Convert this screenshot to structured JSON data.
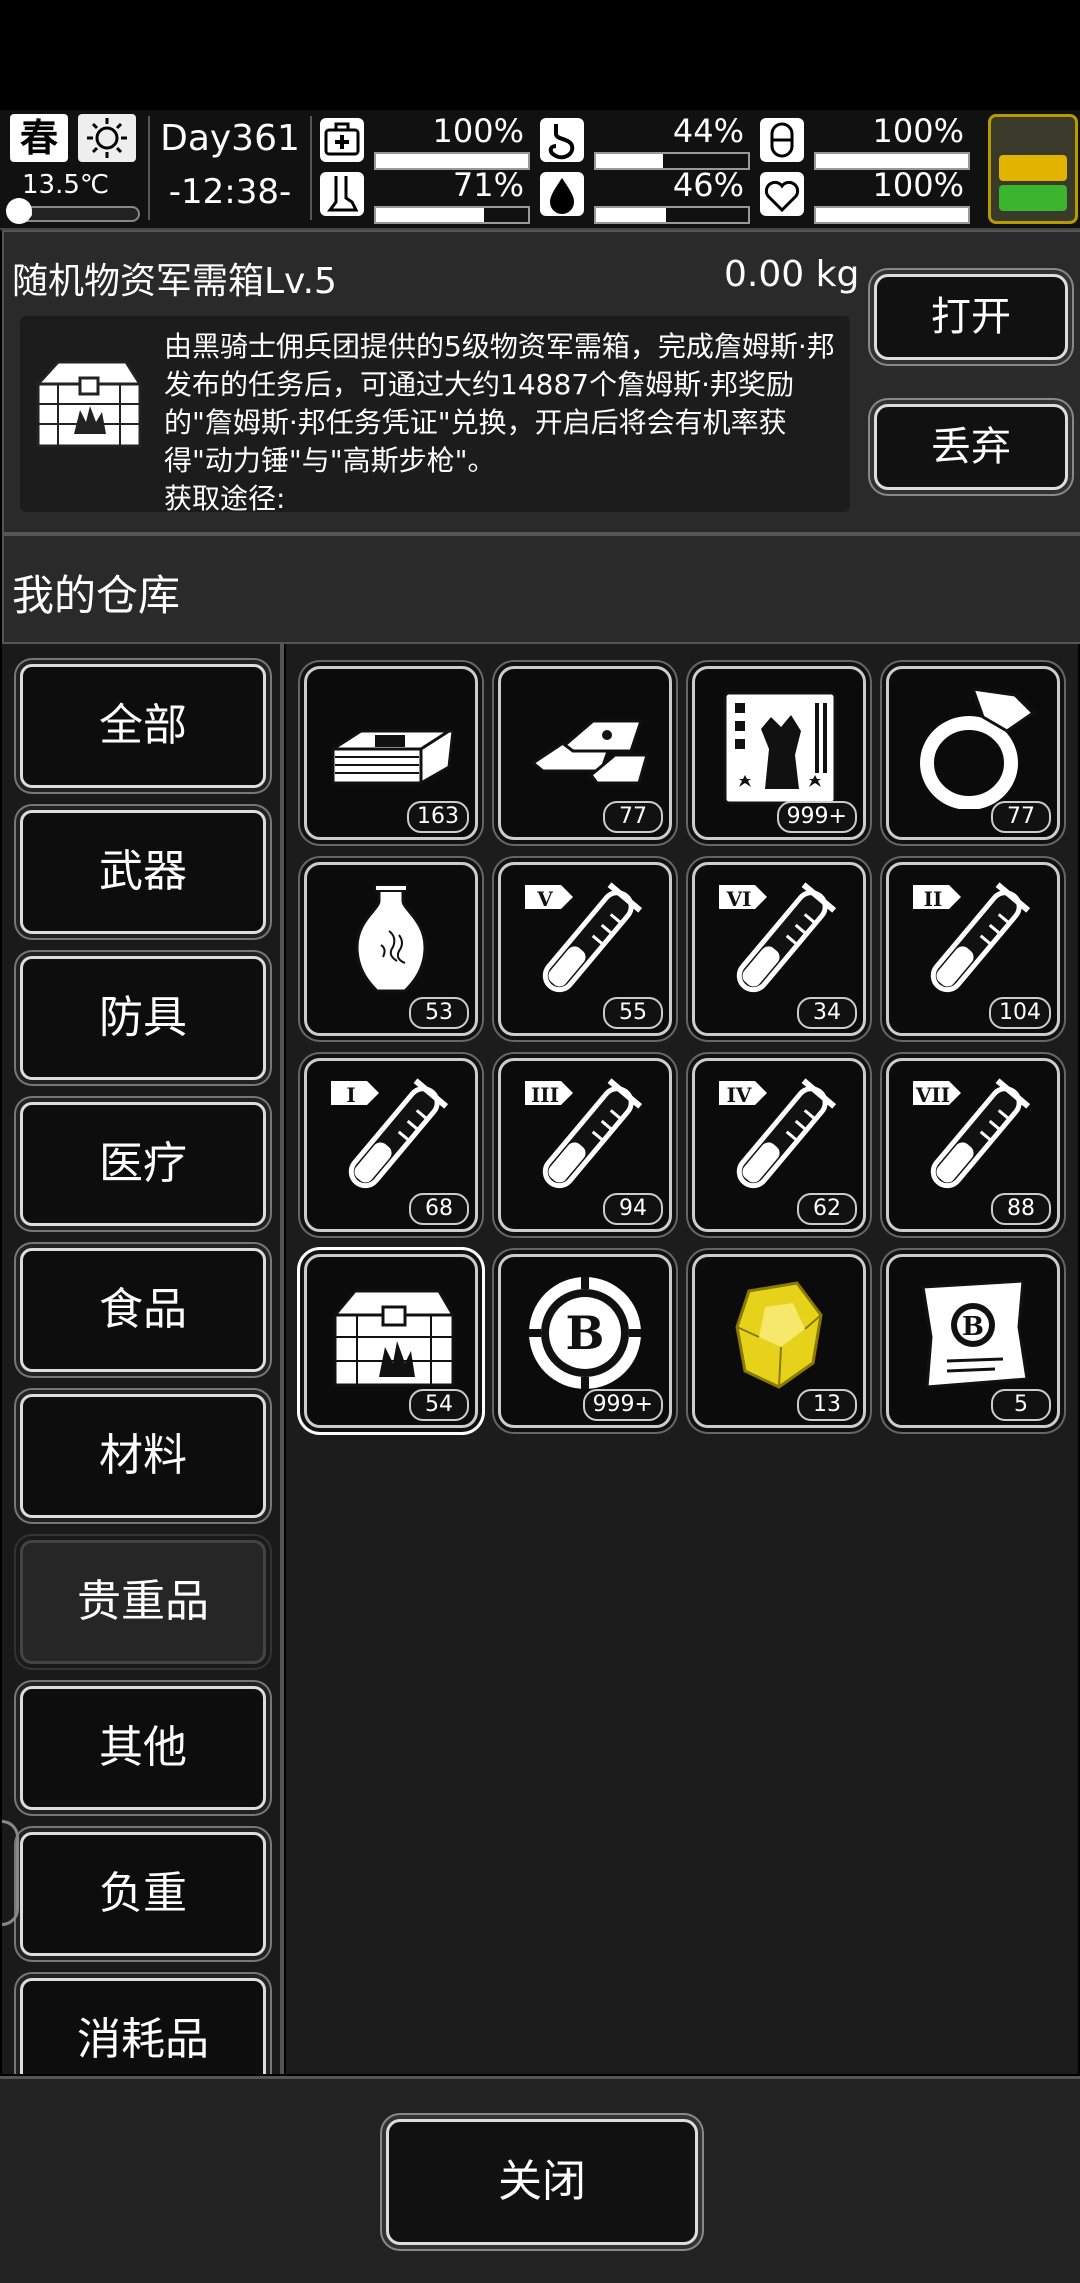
{
  "status": {
    "season": "春",
    "weather_icon": "sun-icon",
    "temperature": "13.5℃",
    "temperature_level": 0.15,
    "day": "Day361",
    "time": "-12:38-",
    "stats": [
      {
        "name": "health",
        "icon": "first-aid-icon",
        "value": "100%",
        "level": 1.0
      },
      {
        "name": "hunger",
        "icon": "stomach-icon",
        "value": "44%",
        "level": 0.44
      },
      {
        "name": "medicine",
        "icon": "pill-icon",
        "value": "100%",
        "level": 1.0
      },
      {
        "name": "stamina",
        "icon": "leg-icon",
        "value": "71%",
        "level": 0.71
      },
      {
        "name": "thirst",
        "icon": "water-drop-icon",
        "value": "46%",
        "level": 0.46
      },
      {
        "name": "mood",
        "icon": "heart-icon",
        "value": "100%",
        "level": 1.0
      }
    ],
    "energy_colors": [
      "#3a3a2a",
      "#e2b400",
      "#3cb52e"
    ]
  },
  "item_detail": {
    "name": "随机物资军需箱Lv.5",
    "weight": "0.00 kg",
    "description": "由黑骑士佣兵团提供的5级物资军需箱，完成詹姆斯·邦发布的任务后，可通过大约14887个詹姆斯·邦奖励的\"詹姆斯·邦任务凭证\"兑换，开启后将会有机率获得\"动力锤\"与\"高斯步枪\"。",
    "source_label": "获取途径:",
    "open_label": "打开",
    "discard_label": "丢弃"
  },
  "warehouse": {
    "title": "我的仓库",
    "categories": [
      "全部",
      "武器",
      "防具",
      "医疗",
      "食品",
      "材料",
      "贵重品",
      "其他",
      "负重",
      "消耗品"
    ],
    "active_category": "贵重品",
    "items": [
      {
        "icon": "cash-bundle-icon",
        "count": "163"
      },
      {
        "icon": "gold-bars-icon",
        "count": "77"
      },
      {
        "icon": "zombie-card-icon",
        "count": "999+"
      },
      {
        "icon": "ring-icon",
        "count": "77"
      },
      {
        "icon": "vase-icon",
        "count": "53"
      },
      {
        "icon": "test-tube-v-icon",
        "count": "55",
        "tag": "V"
      },
      {
        "icon": "test-tube-vi-icon",
        "count": "34",
        "tag": "VI"
      },
      {
        "icon": "test-tube-ii-icon",
        "count": "104",
        "tag": "II"
      },
      {
        "icon": "test-tube-i-icon",
        "count": "68",
        "tag": "I"
      },
      {
        "icon": "test-tube-iii-icon",
        "count": "94",
        "tag": "III"
      },
      {
        "icon": "test-tube-iv-icon",
        "count": "62",
        "tag": "IV"
      },
      {
        "icon": "test-tube-vii-icon",
        "count": "88",
        "tag": "VII"
      },
      {
        "icon": "supply-crate-icon",
        "count": "54",
        "selected": true
      },
      {
        "icon": "b-chip-icon",
        "count": "999+"
      },
      {
        "icon": "gold-nugget-icon",
        "count": "13"
      },
      {
        "icon": "b-voucher-icon",
        "count": "5"
      }
    ]
  },
  "bottom": {
    "close_label": "关闭"
  }
}
